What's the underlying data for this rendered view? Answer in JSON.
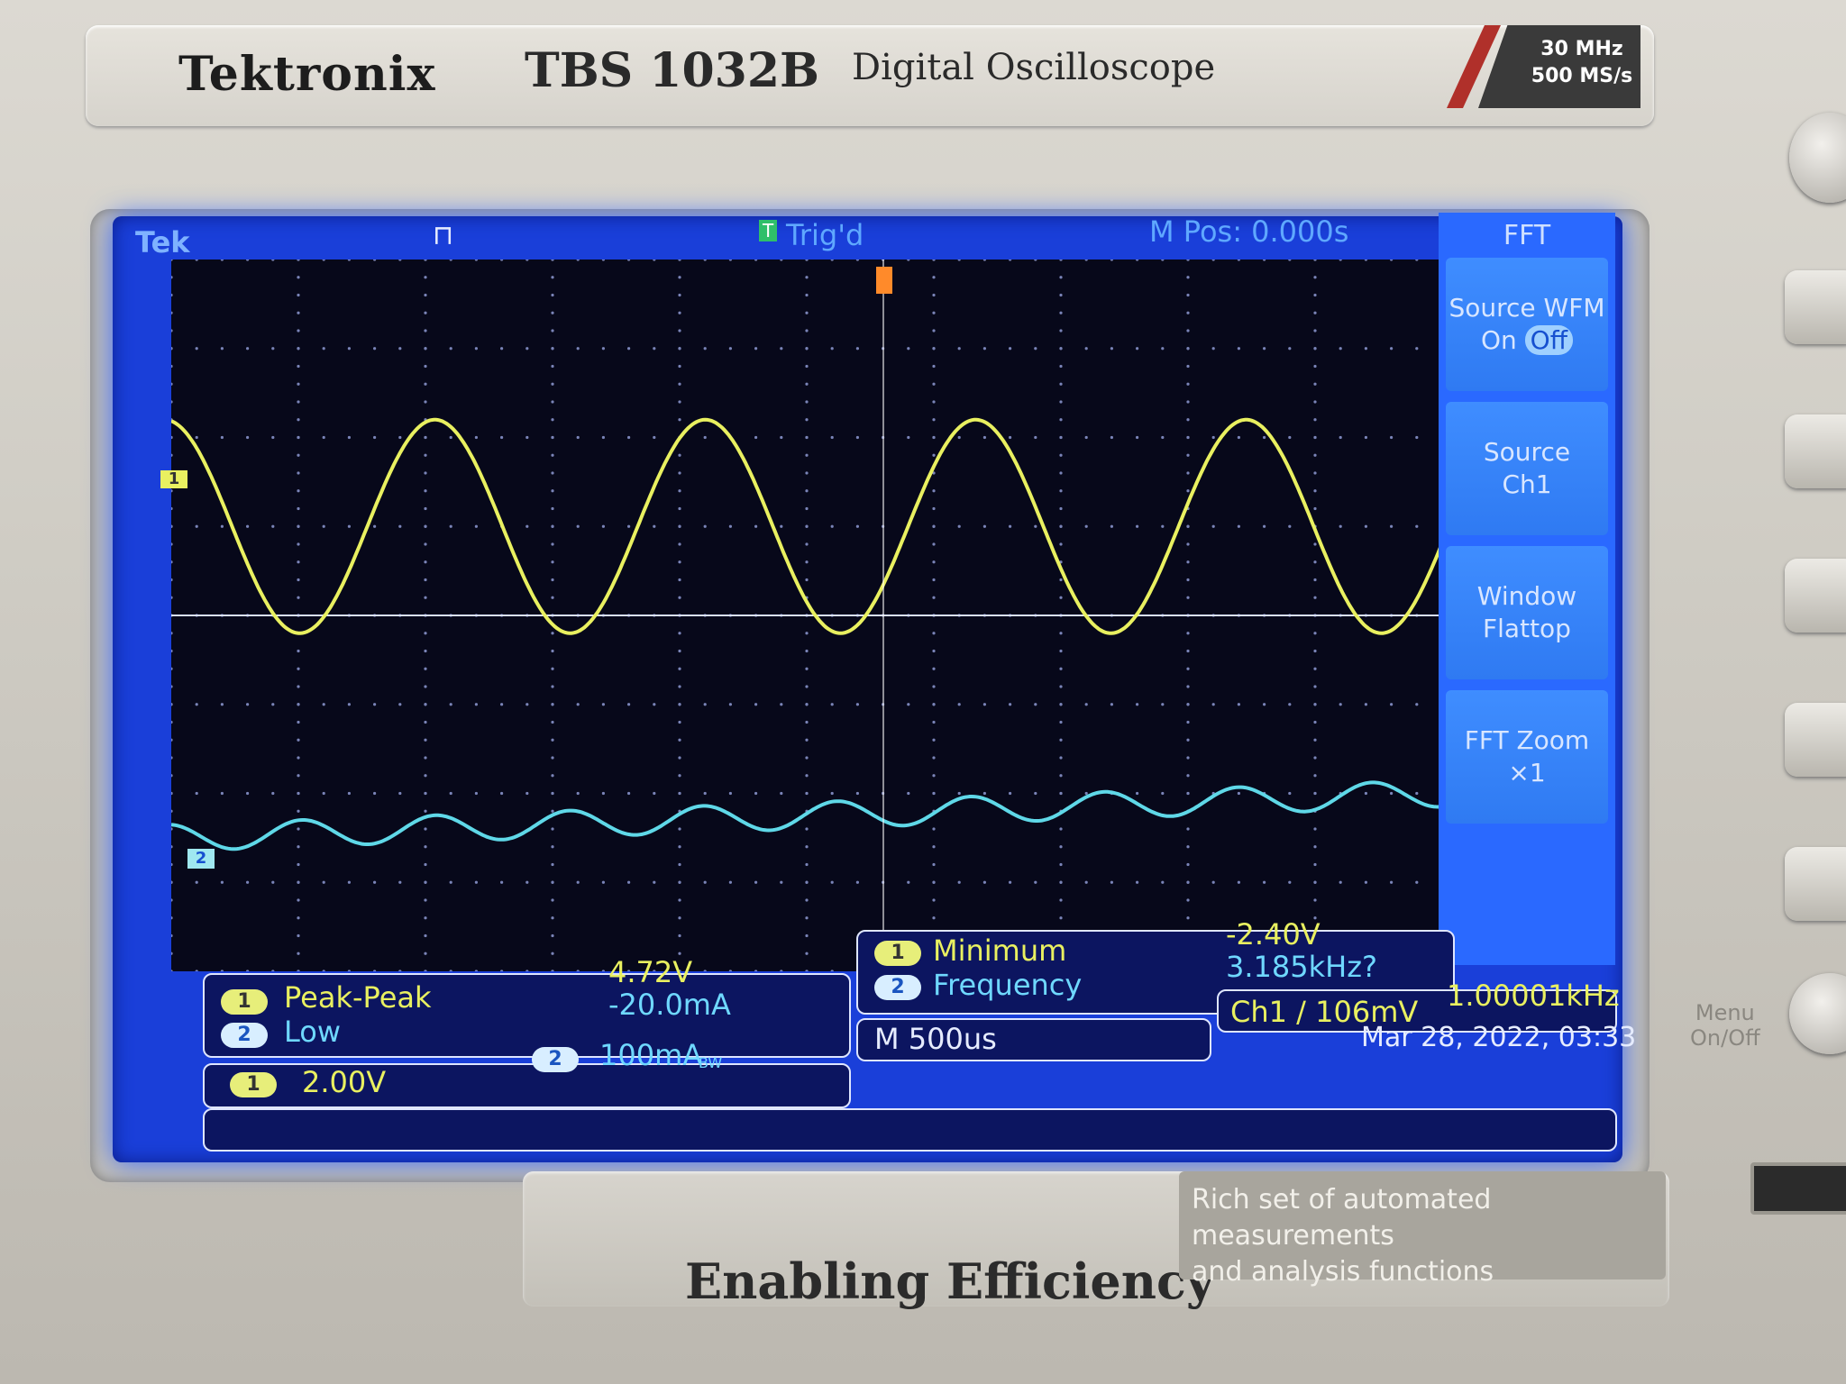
{
  "device": {
    "brand": "Tektronix",
    "model": "TBS 1032B",
    "description": "Digital Oscilloscope",
    "spec_bandwidth": "30 MHz",
    "spec_samplerate": "500 MS/s",
    "tagline": "Enabling Efficiency",
    "feature_line1": "Rich set of automated measurements",
    "feature_line2": "and analysis functions",
    "menu_button_line1": "Menu",
    "menu_button_line2": "On/Off"
  },
  "status": {
    "logo": "Tek",
    "trigger_state": "Trig'd",
    "trigger_marker": "T",
    "m_pos": "M Pos: 0.000s"
  },
  "side_menu": {
    "title": "FFT",
    "items": [
      {
        "line1": "Source WFM",
        "on": "On",
        "off": "Off"
      },
      {
        "line1": "Source",
        "line2": "Ch1"
      },
      {
        "line1": "Window",
        "line2": "Flattop"
      },
      {
        "line1": "FFT Zoom",
        "line2": "×1"
      }
    ]
  },
  "channel_markers": {
    "ch1": "1",
    "ch2": "2"
  },
  "measurements": {
    "row1_label": "Peak-Peak",
    "row1_value": "4.72V",
    "row2_label": "Low",
    "row2_value": "-20.0mA",
    "row3_label": "Minimum",
    "row3_value": "-2.40V",
    "row4_label": "Frequency",
    "row4_value": "3.185kHz?"
  },
  "scales": {
    "ch1_scale": "2.00V",
    "ch2_scale": "100mA",
    "ch2_bw": "BW",
    "timebase": "M 500us",
    "trigger": "Ch1 ∕ 106mV",
    "trigger_freq": "1.00001kHz",
    "datetime": "Mar 28, 2022, 03:33"
  },
  "colors": {
    "ch1": "#e9f060",
    "ch2": "#5fd8e8",
    "screen_blue": "#1a3fd9"
  },
  "chart_data": {
    "type": "line",
    "xlabel": "",
    "ylabel": "",
    "series": [
      {
        "channel": "1",
        "shape": "sine",
        "divisions_amplitude": 1.2,
        "cycles": 4.7,
        "center_div": 1.0
      },
      {
        "channel": "2",
        "shape": "sine",
        "divisions_amplitude": 0.15,
        "cycles": 9.5,
        "center_div": -2.5,
        "trend": 0.5
      }
    ],
    "grid": true,
    "divisions": [
      10,
      8
    ]
  }
}
